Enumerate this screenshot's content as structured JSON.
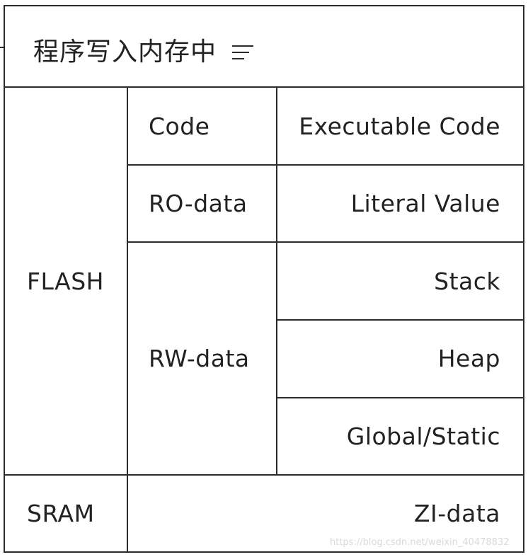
{
  "title": "程序写入内存中",
  "icons": {
    "title_icon": "list-lines-icon"
  },
  "blocks": {
    "flash": "FLASH",
    "sram": "SRAM",
    "code": "Code",
    "ro_data": "RO-data",
    "rw_data": "RW-data",
    "executable_code": "Executable Code",
    "literal_value": "Literal Value",
    "stack": "Stack",
    "heap": "Heap",
    "global_static": "Global/Static",
    "zi_data": "ZI-data"
  },
  "watermark": "https://blog.csdn.net/weixin_40478832"
}
